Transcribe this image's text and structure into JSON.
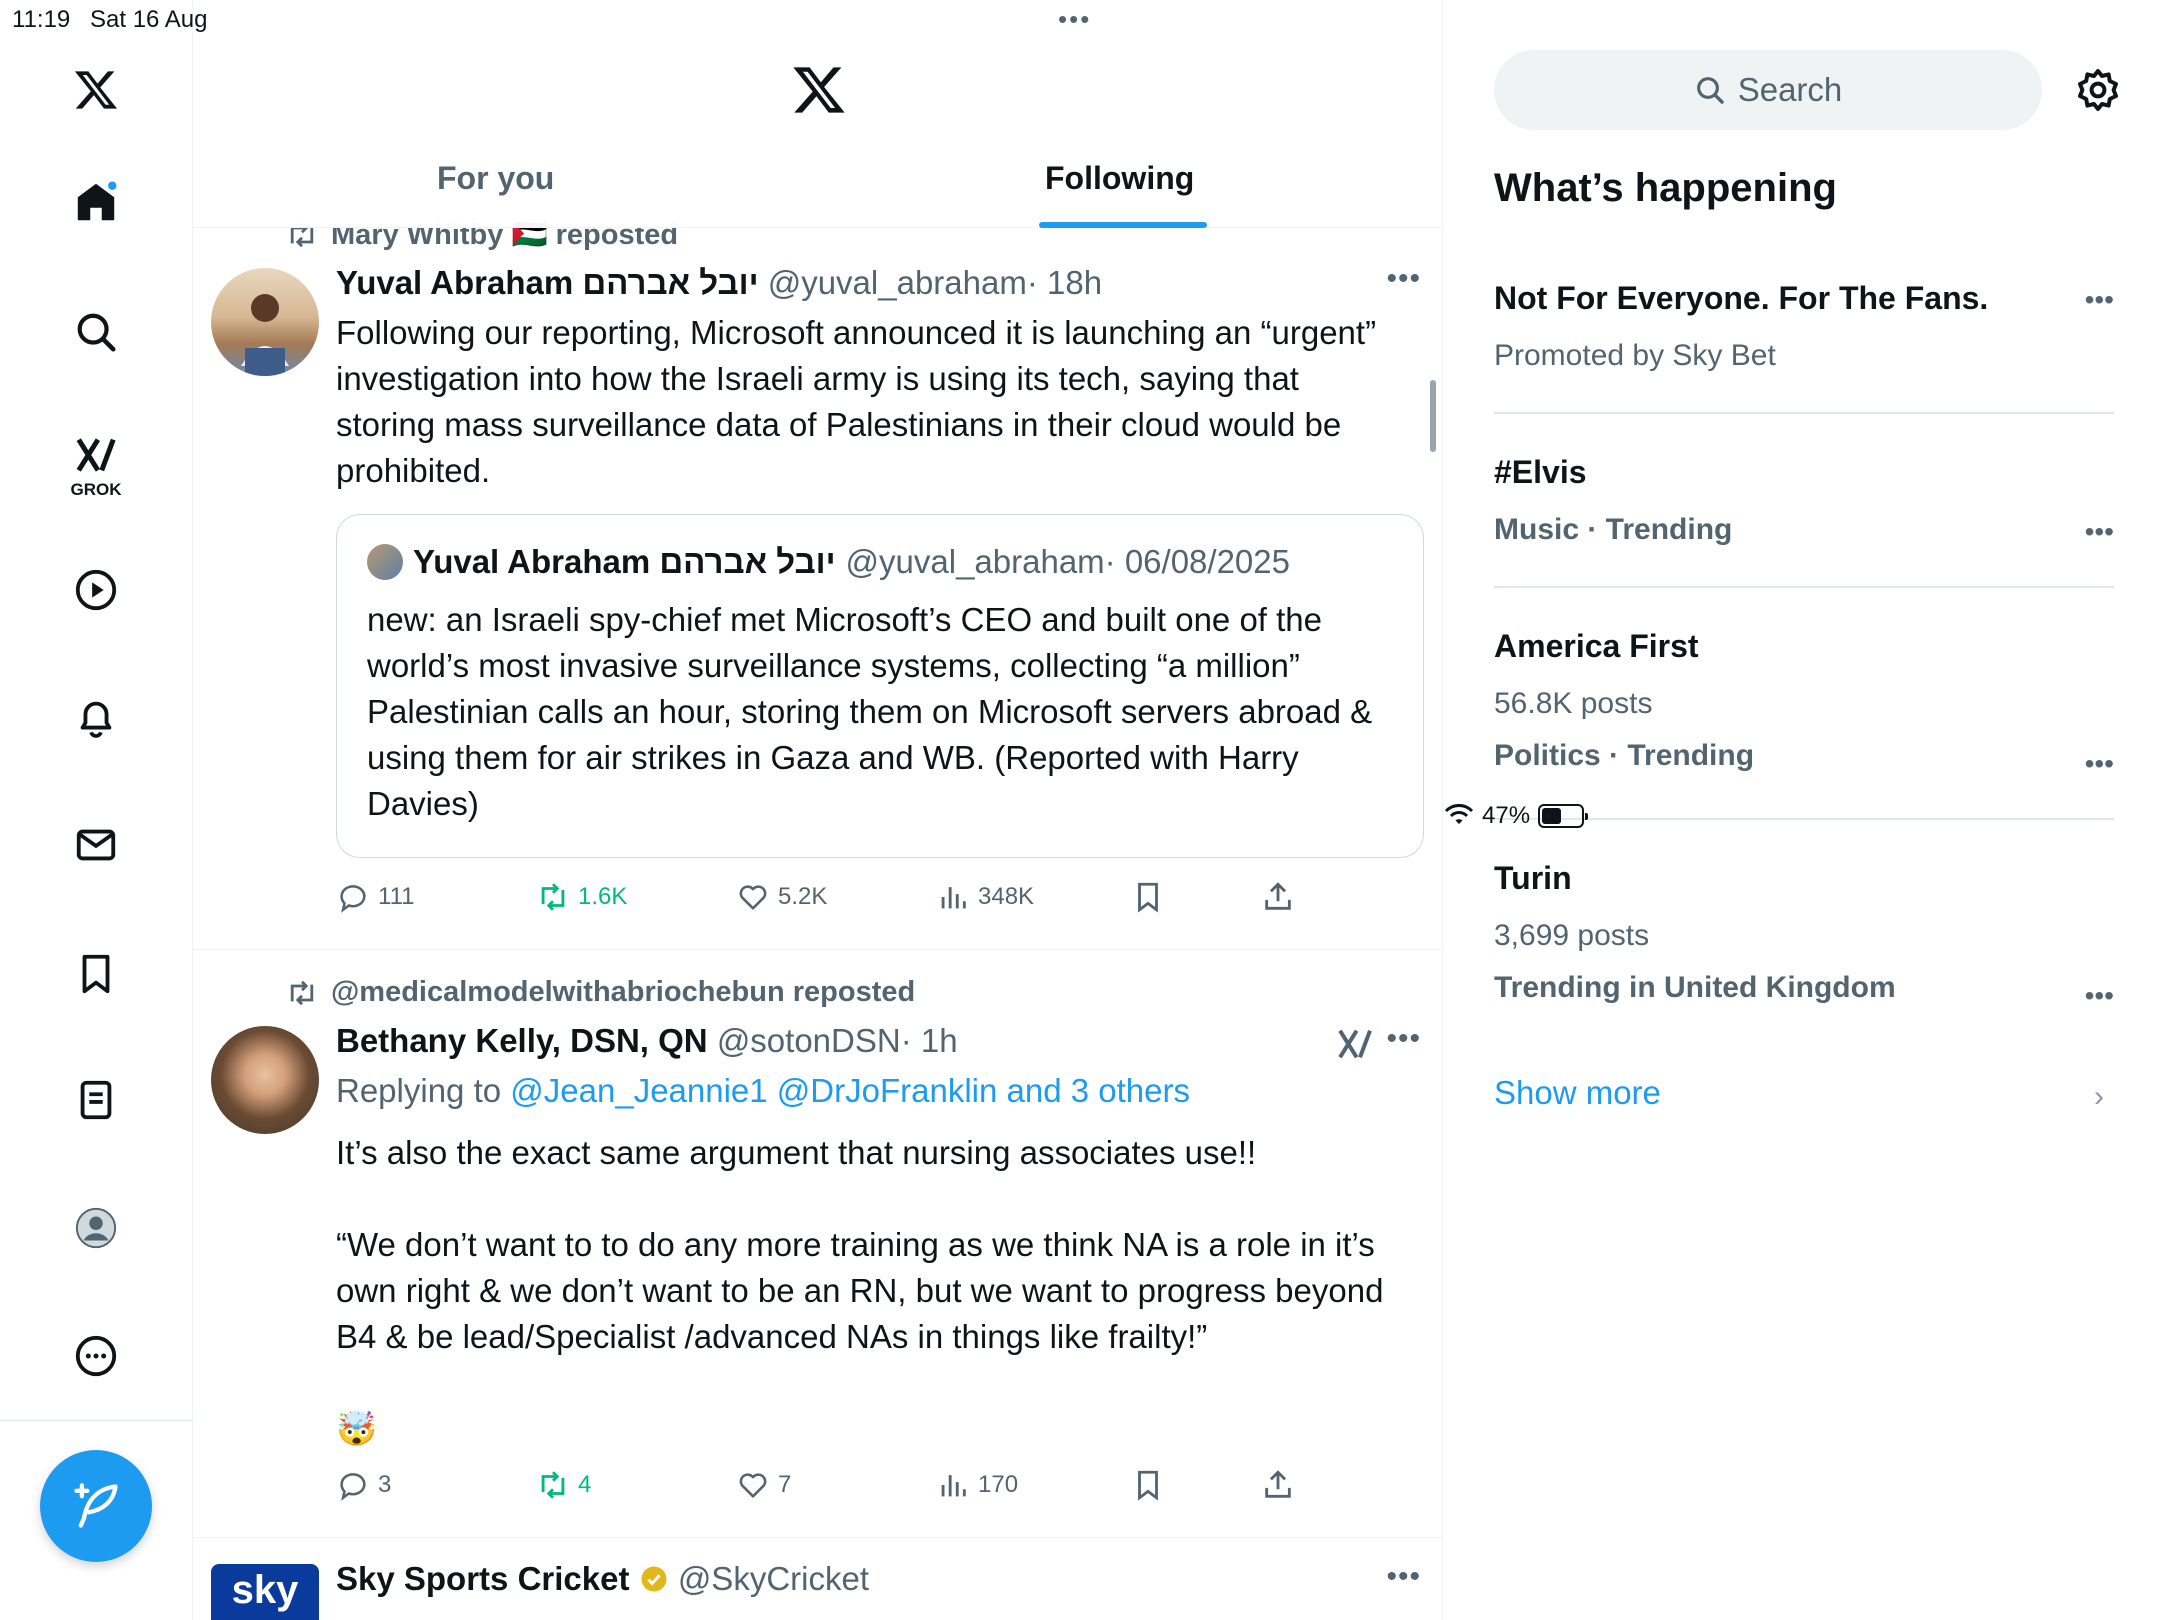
{
  "status_bar": {
    "time": "11:19",
    "date": "Sat 16 Aug",
    "battery": "47%",
    "battery_level": 0.47
  },
  "nav": {
    "grok_label": "GROK",
    "items": [
      "x-logo-icon",
      "home-icon",
      "search-icon",
      "grok-icon",
      "video-icon",
      "bell-icon",
      "mail-icon",
      "bookmark-icon",
      "lists-icon",
      "profile-icon",
      "more-icon"
    ]
  },
  "tabs": {
    "for_you": "For you",
    "following": "Following"
  },
  "posts": [
    {
      "repost_by": "Mary Whitby 🇵🇸 reposted",
      "name": "Yuval Abraham יובל אברהם",
      "handle": "@yuval_abraham",
      "time": "· 18h",
      "text": "Following our reporting, Microsoft announced it is launching an “urgent” investigation into how the Israeli army is using its tech, saying that storing mass surveillance data of Palestinians in their cloud would be prohibited.",
      "quote": {
        "name": "Yuval Abraham יובל אברהם",
        "handle": "@yuval_abraham",
        "time": "· 06/08/2025",
        "text": "new: an Israeli spy-chief met Microsoft’s CEO and built one of the world’s most invasive surveillance systems, collecting “a million” Palestinian calls an hour, storing them on Microsoft servers abroad & using them for air strikes in Gaza and WB. (Reported with Harry Davies)"
      },
      "replies": "111",
      "reposts": "1.6K",
      "likes": "5.2K",
      "views": "348K"
    },
    {
      "repost_by": "@medicalmodelwithabriochebun reposted",
      "name": "Bethany Kelly, DSN, QN",
      "handle": "@sotonDSN",
      "time": "· 1h",
      "replying_prefix": "Replying to",
      "replying_to": "@Jean_Jeannie1 @DrJoFranklin and 3 others",
      "text": "It’s also the exact same argument that nursing associates use!!\n\n“We don’t want to to do any more training as we think NA is a role in it’s own right & we don’t want to be an RN, but we want to progress beyond B4 & be lead/Specialist /advanced NAs in things like frailty!”\n\n🤯",
      "replies": "3",
      "reposts": "4",
      "likes": "7",
      "views": "170"
    },
    {
      "name": "Sky Sports Cricket",
      "handle": "@SkyCricket",
      "avatar_text": "sky"
    }
  ],
  "right": {
    "search_placeholder": "Search",
    "heading": "What’s happening",
    "trends": [
      {
        "title": "Not For Everyone. For The Fans.",
        "sub": "Promoted by Sky Bet"
      },
      {
        "title": "#Elvis",
        "meta": "Music · Trending"
      },
      {
        "title": "America First",
        "posts": "56.8K posts",
        "meta": "Politics · Trending"
      },
      {
        "title": "Turin",
        "posts": "3,699 posts",
        "meta": "Trending in United Kingdom"
      }
    ],
    "show_more": "Show more"
  },
  "colors": {
    "accent": "#1d9bf0",
    "repost_green": "#00ba7c",
    "secondary": "#536471"
  }
}
